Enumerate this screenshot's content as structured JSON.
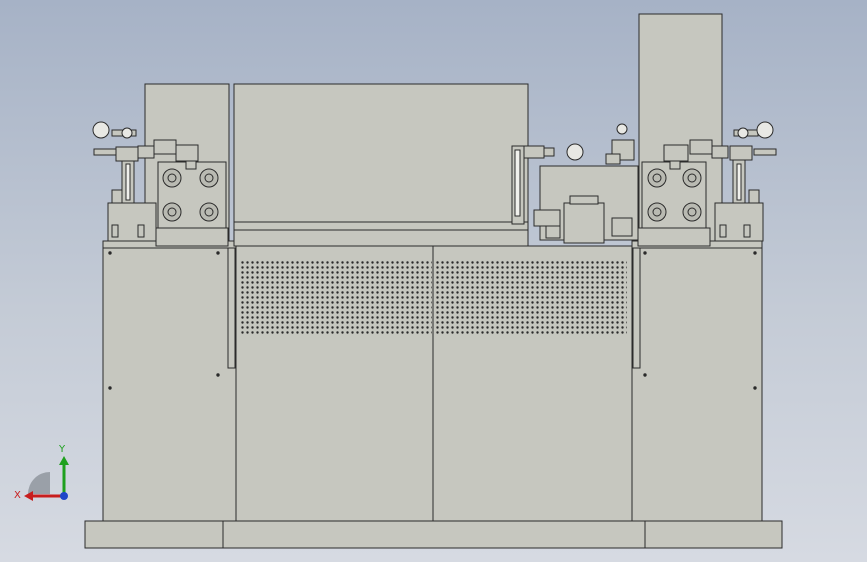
{
  "viewport": {
    "background_top": "#a6b2c6",
    "background_bottom": "#d6dae2",
    "part_fill": "#c6c7bf",
    "part_stroke": "#2b2b2b"
  },
  "model": {
    "view": "front",
    "parts": [
      "base-plinth",
      "left-cabinet",
      "right-cabinet",
      "center-cabinet",
      "top-center-housing",
      "left-tall-box",
      "right-tall-box",
      "left-pump-assembly",
      "right-pump-assembly",
      "center-pump-assembly",
      "pressure-gauges",
      "perforated-vent-panels"
    ]
  },
  "triad": {
    "x_label": "X",
    "y_label": "Y",
    "x_color": "#c81e1e",
    "y_color": "#1ea01e",
    "z_color": "#1e46c8"
  }
}
